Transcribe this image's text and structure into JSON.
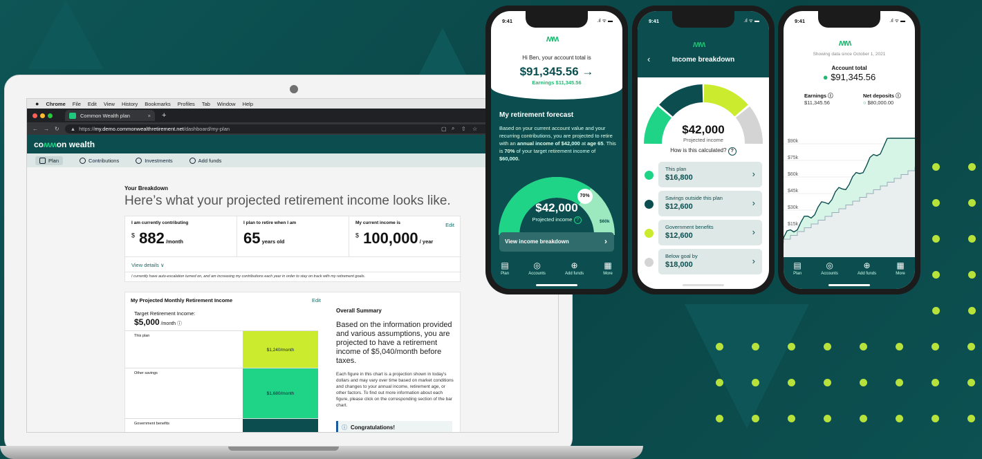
{
  "colors": {
    "bg": "#0b4c4d",
    "brand_dark": "#0c4e4f",
    "green": "#1fd387",
    "lime": "#cbeb2f",
    "light_green": "#9ce9c0"
  },
  "mac_menu": {
    "apple": "",
    "app": "Chrome",
    "items": [
      "File",
      "Edit",
      "View",
      "History",
      "Bookmarks",
      "Profiles",
      "Tab",
      "Window",
      "Help"
    ]
  },
  "browser": {
    "tab_title": "Common Wealth plan",
    "url_prefix": "https://",
    "url_domain": "my.demo.commonwealthretirement.net",
    "url_path": "/dashboard/my-plan"
  },
  "brand": {
    "logo_a": "co",
    "logo_mm": "ʍʍ",
    "logo_b": "on",
    "logo_c": " wealth"
  },
  "nav": {
    "plan": "Plan",
    "contributions": "Contributions",
    "investments": "Investments",
    "add_funds": "Add funds"
  },
  "breakdown": {
    "title": "Your Breakdown",
    "headline": "Here’s what your projected retirement income looks like.",
    "contrib_label": "I am currently contributing",
    "contrib_value": "882",
    "contrib_unit": " /month",
    "dollar": "$",
    "retire_label": "I plan to retire when I am",
    "retire_value": "65",
    "retire_unit": " years old",
    "income_label": "My current income is",
    "income_value": "100,000",
    "income_unit": " / year",
    "edit": "Edit",
    "view_details": "View details  ∨",
    "auto_note": "I currently have auto-escalation turned on, and am increasing my contributions each year in order to stay on track with my retirement goals."
  },
  "projected": {
    "title": "My Projected Monthly Retirement Income",
    "edit": "Edit",
    "target_label": "Target Retirement Income:",
    "target_value": "$5,000",
    "target_unit": " /month ⓘ",
    "rows": [
      {
        "label": "This plan",
        "bar": "$1,240/month"
      },
      {
        "label": "Other savings",
        "bar": "$1,680/month"
      },
      {
        "label": "Government benefits",
        "bar": ""
      }
    ]
  },
  "summary": {
    "title": "Overall Summary",
    "para": "Based on the information provided and various assumptions, you are projected to have a retirement income of $5,040/month before taxes.",
    "small": "Each figure in this chart is a projection shown in today's dollars and may vary over time based on market conditions and changes to your annual income, retirement age, or other factors. To find out more information about each figure, please click on the corresponding section of the bar chart.",
    "congrats": "Congratulations!"
  },
  "phone1": {
    "time": "9:41",
    "greeting": "Hi Ben, your account total is",
    "total": "$91,345.56 →",
    "earnings": "Earnings $11,345.56",
    "forecast_title": "My retirement forecast",
    "forecast_text_1": "Based on your current account value and your recurring contributions, you are projected to retire with an ",
    "forecast_bold_1": "annual income of $42,000",
    "forecast_text_2": " at ",
    "forecast_bold_2": "age 65",
    "forecast_text_3": ". This is ",
    "forecast_bold_3": "70%",
    "forecast_text_4": " of your target retirement income of ",
    "forecast_bold_4": "$60,000.",
    "gauge_value": "$42,000",
    "gauge_label": "Projected income",
    "gauge_pct": "70%",
    "gauge_max": "$60k",
    "gauge_fraction": 0.7,
    "button": "View income breakdown"
  },
  "phone2": {
    "time": "9:41",
    "title": "Income breakdown",
    "value": "$42,000",
    "value_label": "Projected income",
    "how": "How is this calculated?",
    "items": [
      {
        "label": "This plan",
        "value": "$16,800",
        "color": "#1fd387"
      },
      {
        "label": "Savings outside this plan",
        "value": "$12,600",
        "color": "#0c4e4f"
      },
      {
        "label": "Government benefits",
        "value": "$12,600",
        "color": "#cbeb2f"
      },
      {
        "label": "Below goal by",
        "value": "$18,000",
        "color": "#d4d4d4"
      }
    ]
  },
  "phone3": {
    "time": "9:41",
    "since": "Showing data since October 1, 2021",
    "total_label": "Account total",
    "total": "$91,345.56",
    "earnings_label": "Earnings ⓘ",
    "earnings": "$11,345.56",
    "deposits_label": "Net deposits ⓘ",
    "deposits": "$80,000.00",
    "yticks": [
      "$90k",
      "$75k",
      "$60k",
      "$45k",
      "$30k",
      "$15k"
    ]
  },
  "tabbar": {
    "plan": "Plan",
    "accounts": "Accounts",
    "add_funds": "Add funds",
    "more": "More"
  }
}
